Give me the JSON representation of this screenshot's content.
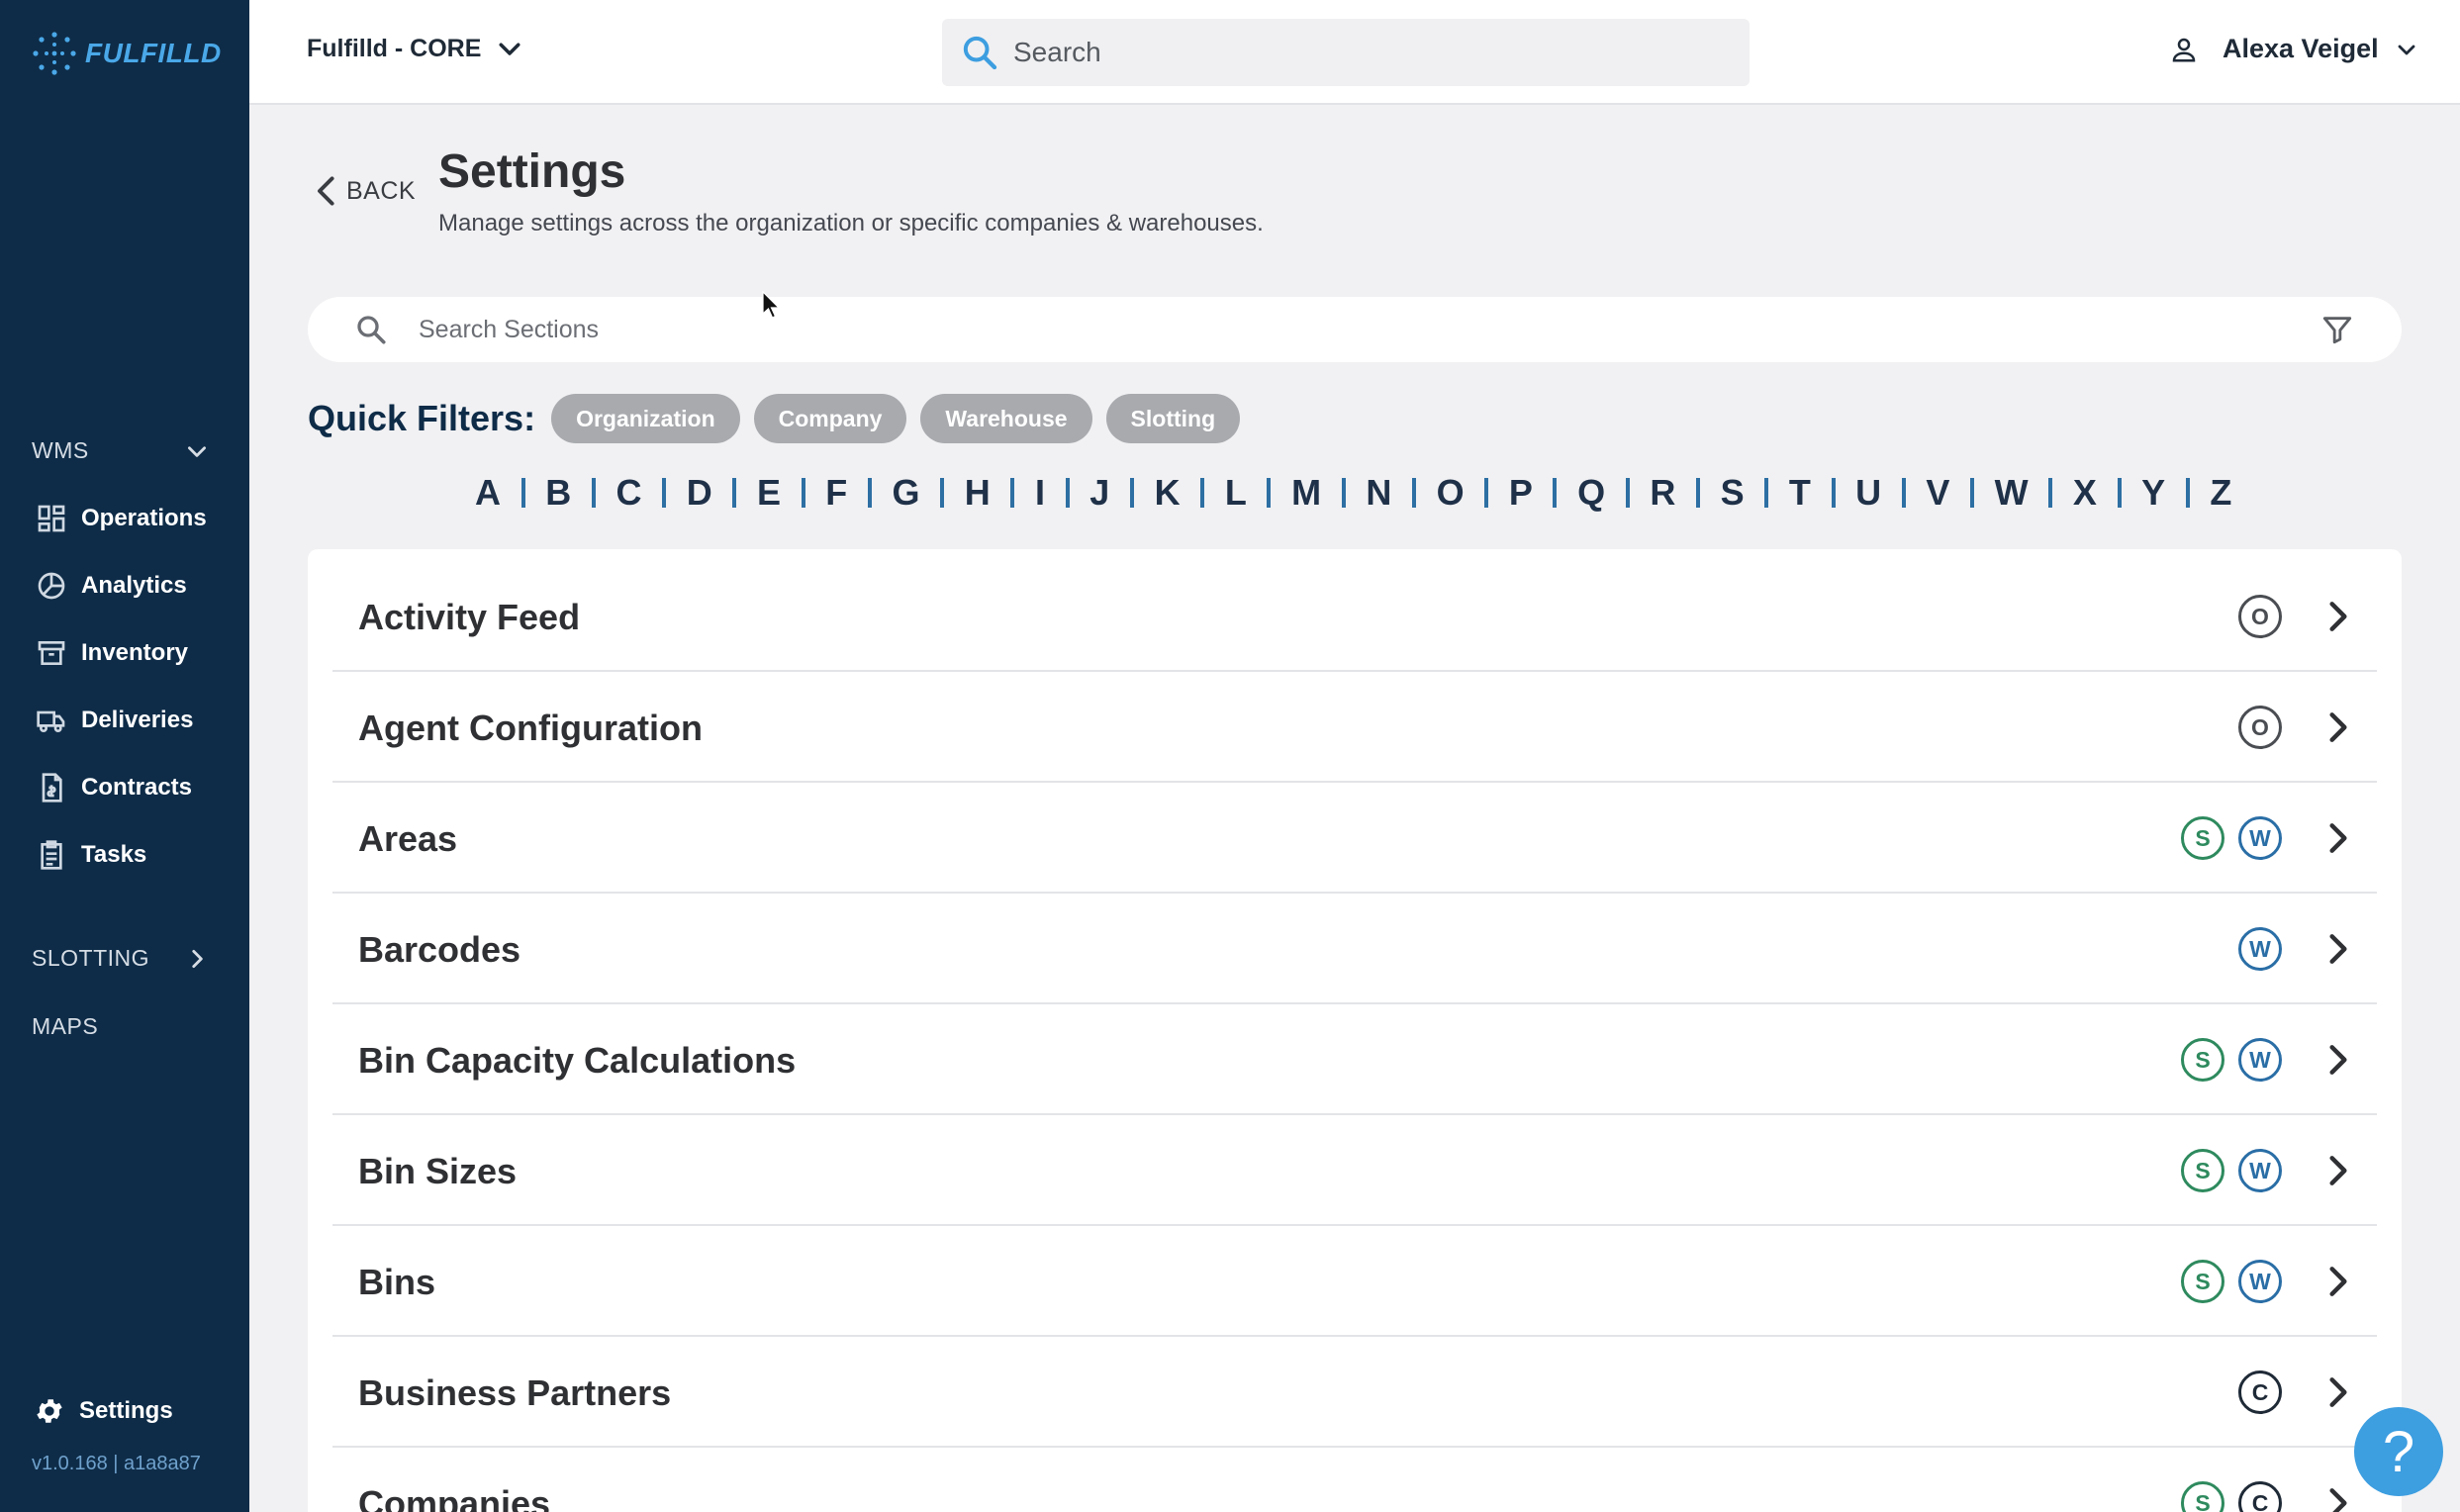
{
  "brand": {
    "name": "FULFILLD",
    "accent": "#4aa8e8",
    "sidebar_bg": "#0e2c48"
  },
  "topbar": {
    "org_selector": "Fulfilld - CORE",
    "search_placeholder": "Search",
    "user_name": "Alexa Veigel"
  },
  "sidebar": {
    "wms_label": "WMS",
    "items": [
      {
        "label": "Operations",
        "icon": "dashboard-icon"
      },
      {
        "label": "Analytics",
        "icon": "pie-chart-icon"
      },
      {
        "label": "Inventory",
        "icon": "archive-box-icon"
      },
      {
        "label": "Deliveries",
        "icon": "truck-icon"
      },
      {
        "label": "Contracts",
        "icon": "contract-document-icon"
      },
      {
        "label": "Tasks",
        "icon": "clipboard-list-icon"
      }
    ],
    "slotting_label": "SLOTTING",
    "maps_label": "MAPS",
    "settings_label": "Settings",
    "version": "v1.0.168 | a1a8a87"
  },
  "header": {
    "back_label": "BACK",
    "title": "Settings",
    "subtitle": "Manage settings across the organization or specific companies & warehouses."
  },
  "section_search": {
    "placeholder": "Search Sections"
  },
  "quick_filters": {
    "label": "Quick Filters:",
    "chips": [
      "Organization",
      "Company",
      "Warehouse",
      "Slotting"
    ]
  },
  "alphabet": [
    "A",
    "B",
    "C",
    "D",
    "E",
    "F",
    "G",
    "H",
    "I",
    "J",
    "K",
    "L",
    "M",
    "N",
    "O",
    "P",
    "Q",
    "R",
    "S",
    "T",
    "U",
    "V",
    "W",
    "X",
    "Y",
    "Z"
  ],
  "sections": [
    {
      "name": "Activity Feed",
      "badges": [
        "O"
      ]
    },
    {
      "name": "Agent Configuration",
      "badges": [
        "O"
      ]
    },
    {
      "name": "Areas",
      "badges": [
        "S",
        "W"
      ]
    },
    {
      "name": "Barcodes",
      "badges": [
        "W"
      ]
    },
    {
      "name": "Bin Capacity Calculations",
      "badges": [
        "S",
        "W"
      ]
    },
    {
      "name": "Bin Sizes",
      "badges": [
        "S",
        "W"
      ]
    },
    {
      "name": "Bins",
      "badges": [
        "S",
        "W"
      ]
    },
    {
      "name": "Business Partners",
      "badges": [
        "C"
      ]
    },
    {
      "name": "Companies",
      "badges": [
        "S",
        "C"
      ]
    }
  ],
  "help": {
    "label": "?"
  }
}
